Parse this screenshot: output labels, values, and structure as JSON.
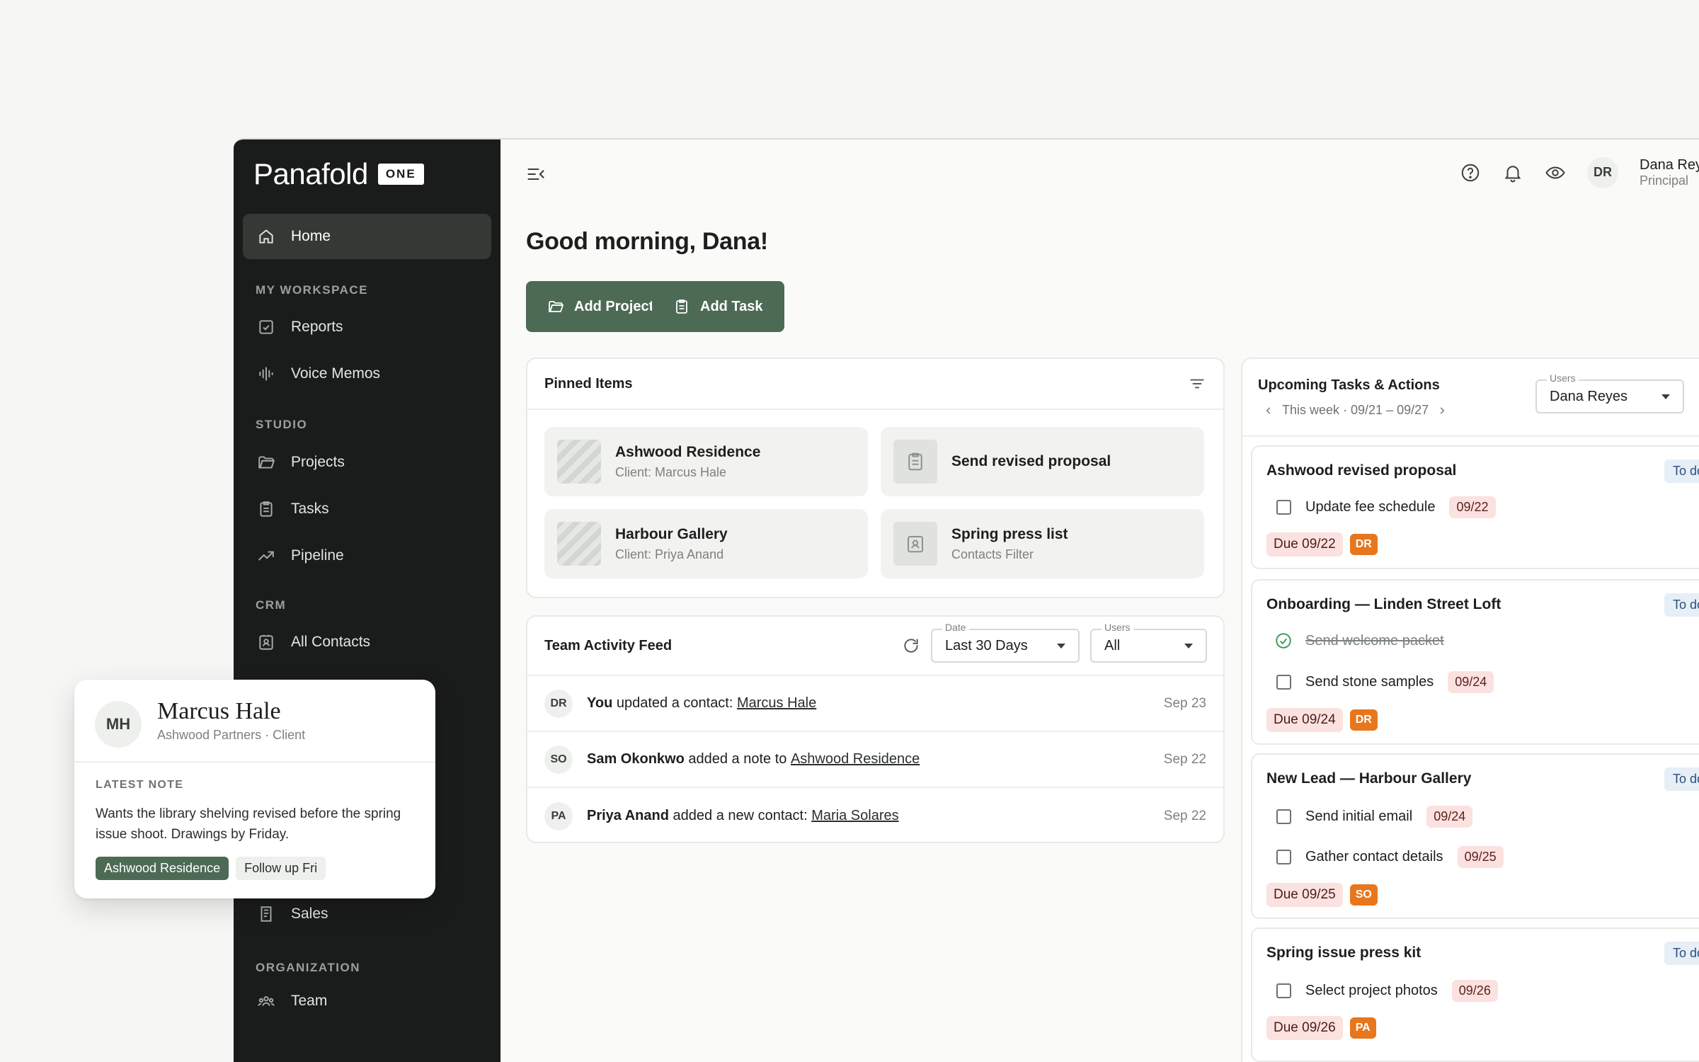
{
  "brand": {
    "name": "Panafold",
    "badge": "ONE"
  },
  "sidebar": {
    "home": "Home",
    "sections": {
      "workspace": "MY WORKSPACE",
      "studio": "STUDIO",
      "crm": "CRM",
      "organization": "ORGANIZATION"
    },
    "items": {
      "reports": "Reports",
      "voice_memos": "Voice Memos",
      "projects": "Projects",
      "tasks": "Tasks",
      "pipeline": "Pipeline",
      "all_contacts": "All Contacts",
      "sales": "Sales",
      "team": "Team"
    }
  },
  "user": {
    "initials": "DR",
    "name": "Dana Reyes",
    "role": "Principal"
  },
  "greeting": "Good morning, Dana!",
  "actions": {
    "add_project": "Add Project",
    "add_task": "Add Task"
  },
  "pinned": {
    "title": "Pinned Items",
    "items": [
      {
        "title": "Ashwood Residence",
        "subtitle": "Client: Marcus Hale"
      },
      {
        "title": "Send revised proposal",
        "subtitle": ""
      },
      {
        "title": "Harbour Gallery",
        "subtitle": "Client: Priya Anand"
      },
      {
        "title": "Spring press list",
        "subtitle": "Contacts Filter"
      }
    ]
  },
  "activity": {
    "title": "Team Activity Feed",
    "date_filter": {
      "label": "Date",
      "value": "Last 30 Days"
    },
    "users_filter": {
      "label": "Users",
      "value": "All"
    },
    "rows": [
      {
        "initials": "DR",
        "actor": "You",
        "action": " updated a contact: ",
        "target": "Marcus Hale",
        "date": "Sep 23"
      },
      {
        "initials": "SO",
        "actor": "Sam Okonkwo",
        "action": " added a note to ",
        "target": "Ashwood Residence",
        "date": "Sep 22"
      },
      {
        "initials": "PA",
        "actor": "Priya Anand",
        "action": " added a new contact: ",
        "target": "Maria Solares",
        "date": "Sep 22"
      }
    ]
  },
  "upcoming": {
    "title": "Upcoming Tasks & Actions",
    "week": "This week · 09/21 – 09/27",
    "users_filter": {
      "label": "Users",
      "value": "Dana Reyes"
    },
    "status_chip": "To do",
    "cards": [
      {
        "title": "Ashwood revised proposal",
        "tasks": [
          {
            "label": "Update fee schedule",
            "date": "09/22",
            "done": false
          }
        ],
        "due": "Due 09/22",
        "owner": "DR"
      },
      {
        "title": "Onboarding — Linden Street Loft",
        "tasks": [
          {
            "label": "Send welcome packet",
            "date": "",
            "done": true
          },
          {
            "label": "Send stone samples",
            "date": "09/24",
            "done": false
          }
        ],
        "due": "Due 09/24",
        "owner": "DR"
      },
      {
        "title": "New Lead — Harbour Gallery",
        "tasks": [
          {
            "label": "Send initial email",
            "date": "09/24",
            "done": false
          },
          {
            "label": "Gather contact details",
            "date": "09/25",
            "done": false
          }
        ],
        "due": "Due 09/25",
        "owner": "SO"
      },
      {
        "title": "Spring issue press kit",
        "tasks": [
          {
            "label": "Select project photos",
            "date": "09/26",
            "done": false
          }
        ],
        "due": "Due 09/26",
        "owner": "PA"
      }
    ]
  },
  "contact_popup": {
    "initials": "MH",
    "name": "Marcus Hale",
    "subtitle": "Ashwood Partners · Client",
    "note_label": "LATEST NOTE",
    "note": "Wants the library shelving revised before the spring issue shoot. Drawings by Friday.",
    "tags": [
      "Ashwood Residence",
      "Follow up Fri"
    ]
  },
  "colors": {
    "sidebar_bg": "#1a1c1b",
    "accent": "#4d6a55",
    "owner_chip": "#e8761c",
    "date_chip": "#fbe1df"
  }
}
